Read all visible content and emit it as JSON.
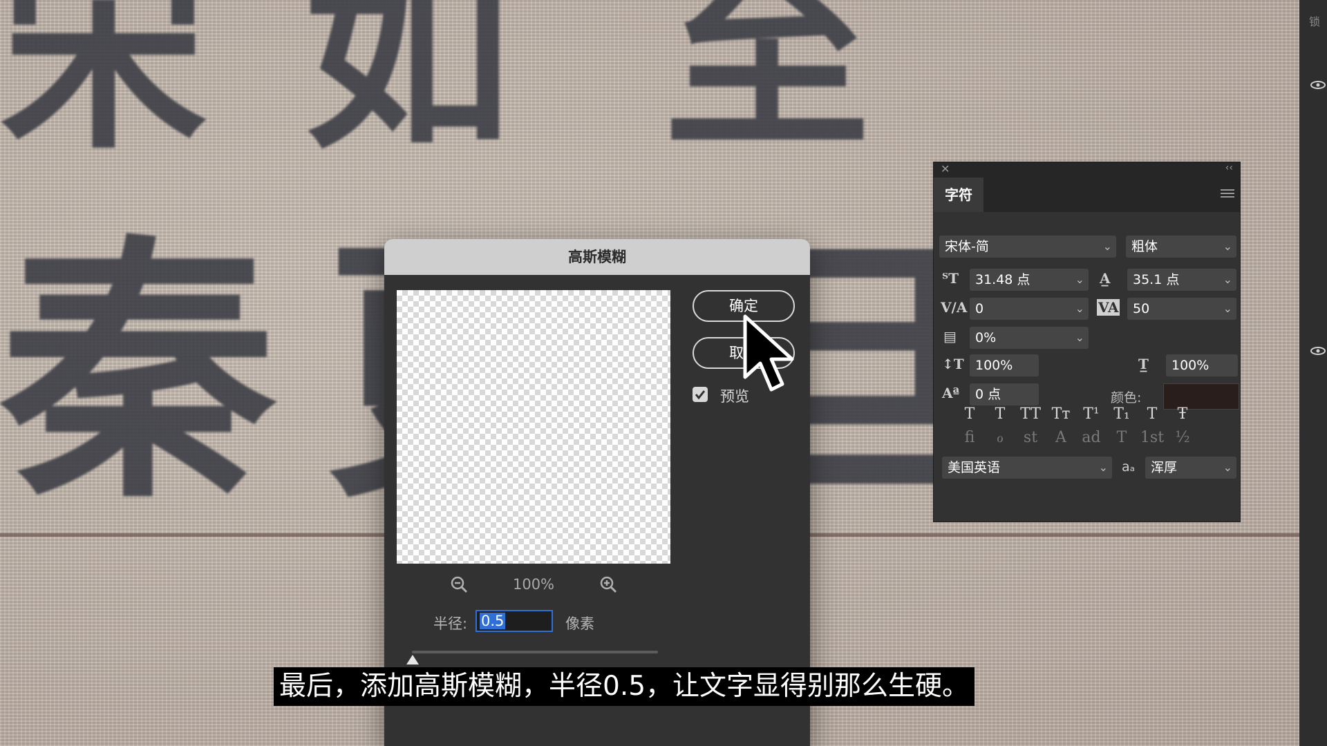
{
  "background": {
    "characters": [
      "宋",
      "如",
      "至",
      "秦",
      "更",
      "旦"
    ],
    "colors": {
      "fabric": "#c2b4a9",
      "ink": "#3a3c44",
      "seam": "#6e5a52"
    }
  },
  "right_strip": {
    "lock_label": "锁",
    "icons": [
      "eye-icon",
      "eye-icon"
    ]
  },
  "gaussian_blur_dialog": {
    "title": "高斯模糊",
    "ok_label": "确定",
    "cancel_label": "取消",
    "preview_checkbox": {
      "label": "预览",
      "checked": true
    },
    "zoom": {
      "value": "100%",
      "zoom_out_icon": "zoom-out-icon",
      "zoom_in_icon": "zoom-in-icon"
    },
    "radius": {
      "label": "半径:",
      "value": "0.5",
      "unit": "像素"
    },
    "slider_fraction": 0.0
  },
  "character_panel": {
    "tab": "字符",
    "font_family": "宋体-简",
    "font_style": "粗体",
    "font_size": "31.48 点",
    "leading": "35.1 点",
    "kerning": "0",
    "tracking": "50",
    "tsume": "0%",
    "vertical_scale": "100%",
    "horizontal_scale": "100%",
    "baseline_shift": "0 点",
    "color_label": "颜色:",
    "color_value": "#2a1e1c",
    "style_buttons": [
      "T",
      "T",
      "TT",
      "Tт",
      "T¹",
      "T₁",
      "T",
      "Ŧ"
    ],
    "opentype_buttons": [
      "ﬁ",
      "ℴ",
      "st",
      "A",
      "ad",
      "T",
      "1st",
      "½"
    ],
    "language": "美国英语",
    "antialias_icon": "aₐ",
    "antialias": "浑厚"
  },
  "subtitle": "最后，添加高斯模糊，半径0.5，让文字显得别那么生硬。"
}
